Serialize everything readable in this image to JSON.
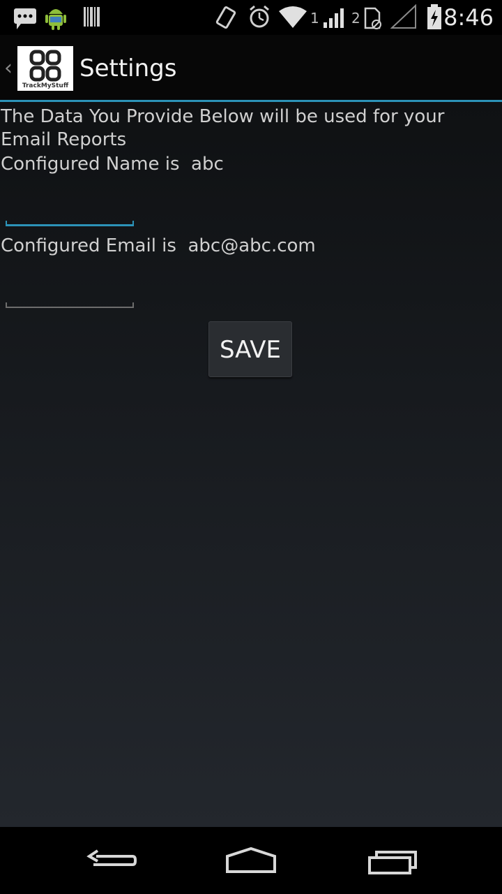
{
  "status_bar": {
    "time": "8:46",
    "sim1_label": "1",
    "sim2_label": "2",
    "icons": [
      "message-icon",
      "android-icon",
      "barcode-icon",
      "vibrate-icon",
      "alarm-icon",
      "wifi-icon",
      "signal-icon",
      "sim-icon",
      "no-signal-icon",
      "battery-charging-icon"
    ]
  },
  "action_bar": {
    "title": "Settings",
    "logo_label": "TrackMyStuff",
    "up_icon": "chevron-left-icon",
    "accent_color": "#2c93b8"
  },
  "content": {
    "intro": "The Data You Provide Below will be used for your Email Reports",
    "name_line": "Configured Name is  abc",
    "name_input": {
      "value": "",
      "placeholder": ""
    },
    "email_line": "Configured Email is  abc@abc.com",
    "email_input": {
      "value": "",
      "placeholder": ""
    },
    "save_label": "SAVE"
  },
  "nav_bar": {
    "icons": [
      "back-icon",
      "home-icon",
      "recent-apps-icon"
    ]
  }
}
